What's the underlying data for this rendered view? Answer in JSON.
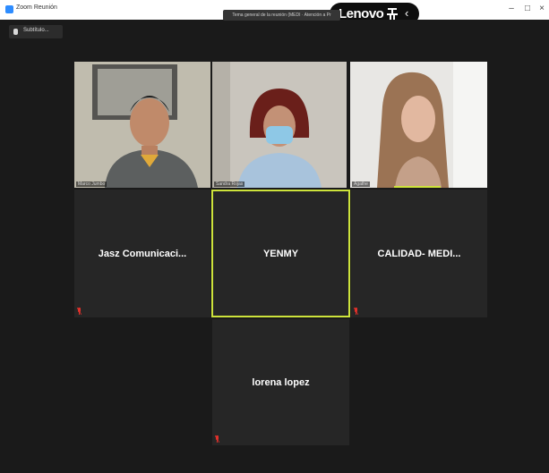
{
  "window": {
    "app_title": "Zoom Reunión",
    "minimize": "–",
    "maximize": "□",
    "close": "×"
  },
  "overlay": {
    "brand": "Lenovo",
    "chevron": "‹"
  },
  "meeting": {
    "subtitle_button": "Subtítulo...",
    "topic": "Tema general de la reunión (MEDI · Atención a Pr"
  },
  "participants": [
    {
      "name_label": "Marco Jumbo",
      "has_video": true
    },
    {
      "name_label": "Sandra Rojas",
      "has_video": true
    },
    {
      "name_label": "Agathe",
      "has_video": true,
      "active_bar": true
    },
    {
      "display_name": "Jasz Comunicaci...",
      "has_video": false,
      "muted": true
    },
    {
      "display_name": "YENMY",
      "has_video": false,
      "active_speaker": true
    },
    {
      "display_name": "CALIDAD- MEDI...",
      "has_video": false,
      "muted": true
    },
    {
      "display_name": "lorena lopez",
      "has_video": false,
      "muted": true
    }
  ],
  "colors": {
    "background": "#1a1a1a",
    "tile": "#262626",
    "active_speaker_border": "#cde33b",
    "muted_icon": "#e0312b"
  }
}
